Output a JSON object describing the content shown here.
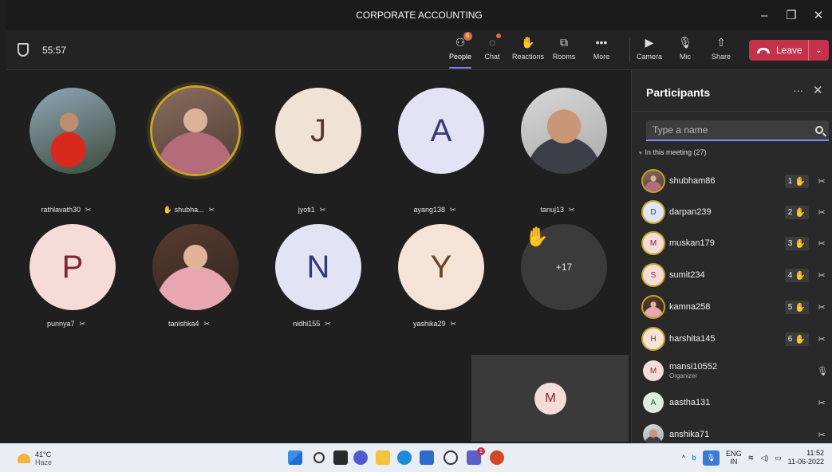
{
  "window": {
    "title": "CORPORATE ACCOUNTING",
    "controls": {
      "minimize": "–",
      "maximize": "❐",
      "close": "✕"
    }
  },
  "toolbar": {
    "timer": "55:57",
    "buttons": [
      {
        "label": "People",
        "icon": "people-icon",
        "badge": "6"
      },
      {
        "label": "Chat",
        "icon": "chat-icon"
      },
      {
        "label": "Reactions",
        "icon": "reactions-icon"
      },
      {
        "label": "Rooms",
        "icon": "rooms-icon"
      },
      {
        "label": "More",
        "icon": "more-icon"
      },
      {
        "label": "Camera",
        "icon": "camera-off-icon"
      },
      {
        "label": "Mic",
        "icon": "mic-icon"
      },
      {
        "label": "Share",
        "icon": "share-icon"
      }
    ],
    "leave_label": "Leave",
    "leave_caret": "⌄"
  },
  "stage": {
    "tiles": [
      {
        "name": "rathlavath30",
        "avatar": "photo",
        "mic": "muted"
      },
      {
        "name": "shubha...",
        "avatar": "photo",
        "mic": "muted",
        "hand": "✋",
        "speaking": true
      },
      {
        "name": "jyoti1",
        "avatar": "J",
        "mic": "muted"
      },
      {
        "name": "ayang138",
        "avatar": "A",
        "mic": "muted"
      },
      {
        "name": "tanuj13",
        "avatar": "photo",
        "mic": "muted"
      },
      {
        "name": "punnya7",
        "avatar": "P",
        "mic": "muted"
      },
      {
        "name": "tanishka4",
        "avatar": "photo",
        "mic": "muted"
      },
      {
        "name": "nidhi155",
        "avatar": "N",
        "mic": "muted"
      },
      {
        "name": "yashika29",
        "avatar": "Y",
        "mic": "muted"
      }
    ],
    "overflow_count": "+17",
    "overflow_hand": "✋",
    "self_initial": "M"
  },
  "panel": {
    "title": "Participants",
    "more": "···",
    "close": "✕",
    "search_placeholder": "Type a name",
    "section_label": "In this meeting (27)",
    "participants": [
      {
        "name": "shubham86",
        "initial": "",
        "hand_order": "1",
        "mic": "muted"
      },
      {
        "name": "darpan239",
        "initial": "D",
        "hand_order": "2",
        "mic": "muted"
      },
      {
        "name": "muskan179",
        "initial": "M",
        "hand_order": "3",
        "mic": "muted"
      },
      {
        "name": "sumit234",
        "initial": "S",
        "hand_order": "4",
        "mic": "muted"
      },
      {
        "name": "kamna258",
        "initial": "",
        "hand_order": "5",
        "mic": "muted"
      },
      {
        "name": "harshita145",
        "initial": "H",
        "hand_order": "6",
        "mic": "muted"
      },
      {
        "name": "mansi10552",
        "initial": "M",
        "role": "Organizer",
        "mic": "on"
      },
      {
        "name": "aastha131",
        "initial": "A",
        "mic": "muted"
      },
      {
        "name": "anshika71",
        "initial": "",
        "mic": "muted"
      }
    ]
  },
  "taskbar": {
    "weather_temp": "41°C",
    "weather_cond": "Haze",
    "lang_top": "ENG",
    "lang_bottom": "IN",
    "time": "11:52",
    "date": "11-06-2022",
    "teams_badge": "1"
  },
  "colors": {
    "accent": "#7f85f5",
    "leave": "#c4314b",
    "hand": "#f0c34a",
    "speaking_ring": "#c9a227"
  }
}
